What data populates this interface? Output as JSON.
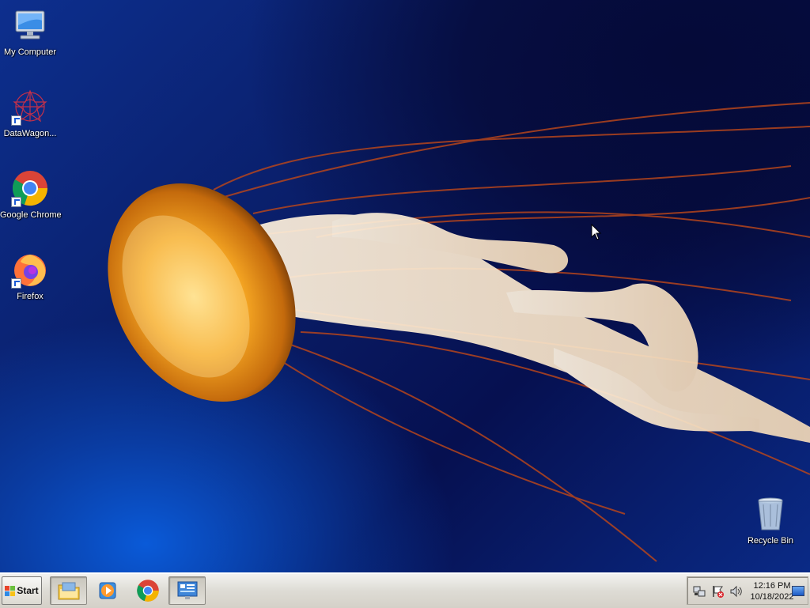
{
  "desktop": {
    "icons": [
      {
        "label": "My Computer"
      },
      {
        "label": "DataWagon..."
      },
      {
        "label": "Google Chrome"
      },
      {
        "label": "Firefox"
      },
      {
        "label": "Recycle Bin"
      }
    ]
  },
  "taskbar": {
    "start_label": "Start",
    "pinned": [
      {
        "icon": "folder-icon",
        "active": true
      },
      {
        "icon": "media-player-icon",
        "active": false
      },
      {
        "icon": "chrome-icon",
        "active": false
      },
      {
        "icon": "control-panel-icon",
        "active": true
      }
    ],
    "tray": {
      "icons": [
        "network-icon",
        "action-center-icon",
        "volume-icon"
      ],
      "time": "12:16 PM",
      "date": "10/18/2022"
    }
  },
  "colors": {
    "desktop_blue": "#0a1f6b",
    "jellyfish_orange": "#f09a1c",
    "tentacle_red": "#b5451c",
    "taskbar": "#d4d0c8"
  }
}
